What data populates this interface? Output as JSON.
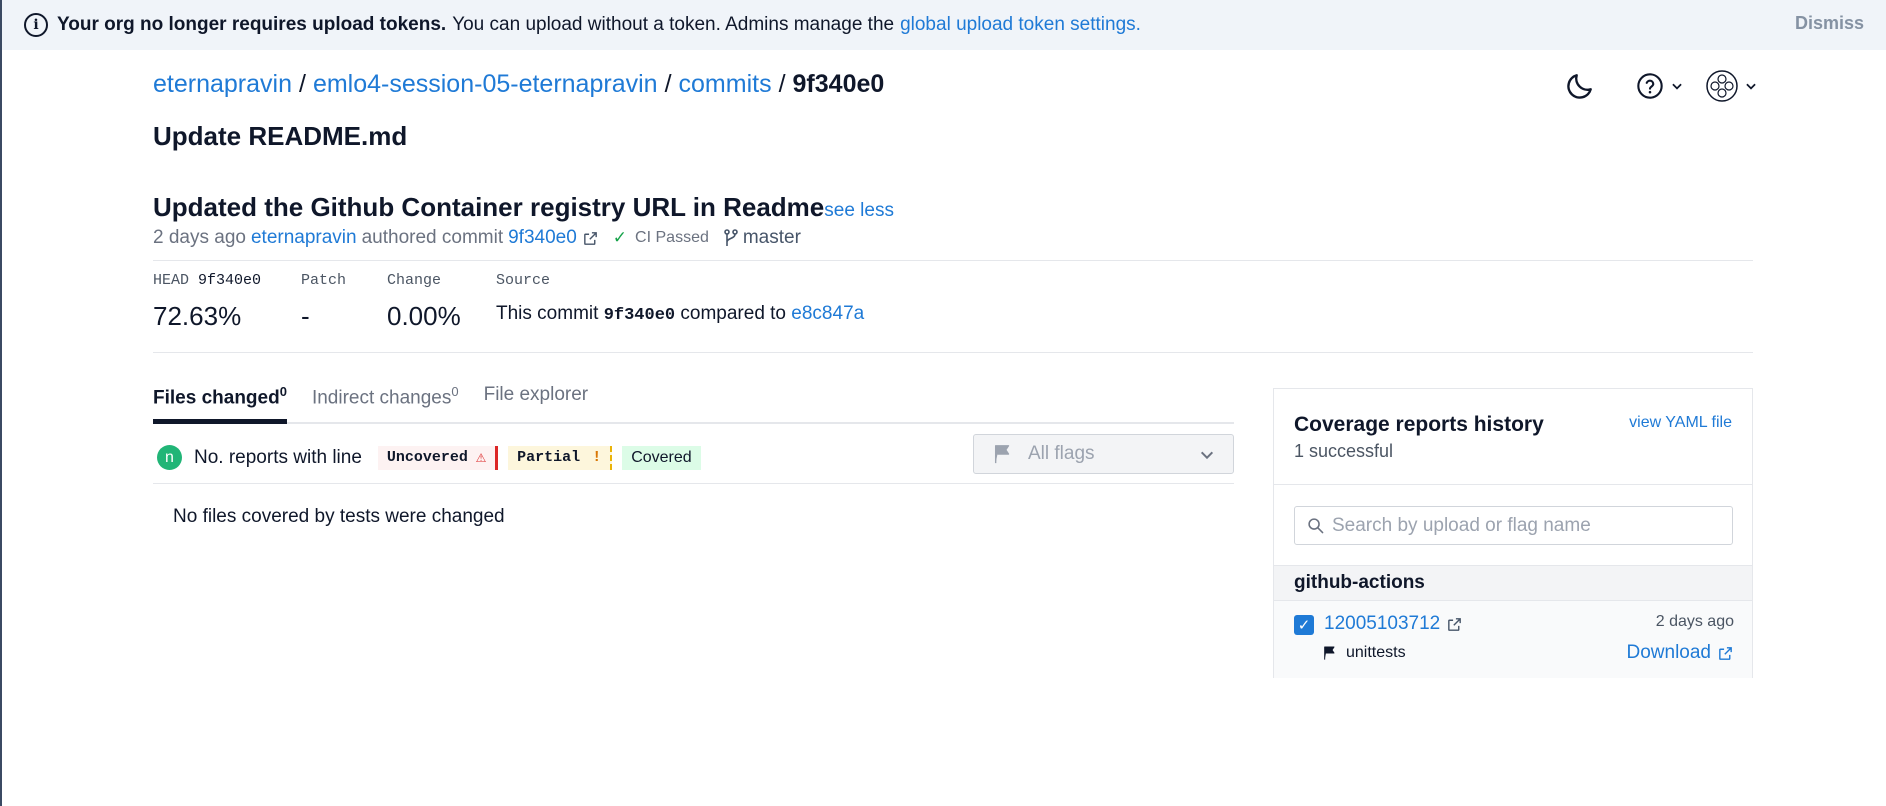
{
  "banner": {
    "bold_text": "Your org no longer requires upload tokens.",
    "text": "You can upload without a token. Admins manage the",
    "link": "global upload token settings.",
    "dismiss": "Dismiss"
  },
  "breadcrumb": {
    "owner": "eternapravin",
    "repo": "emlo4-session-05-eternapravin",
    "section": "commits",
    "current": "9f340e0",
    "separator": "/"
  },
  "page": {
    "title": "Update README.md"
  },
  "commit": {
    "message": "Updated the Github Container registry URL in Readme",
    "see_less": "see less",
    "time": "2 days ago",
    "author": "eternapravin",
    "authored_text": "authored commit",
    "sha": "9f340e0",
    "ci_status": "CI Passed",
    "branch": "master"
  },
  "stats": {
    "head_label": "HEAD",
    "head_sha": "9f340e0",
    "head_value": "72.63%",
    "patch_label": "Patch",
    "patch_value": "-",
    "change_label": "Change",
    "change_value": "0.00%",
    "source_label": "Source",
    "source_prefix": "This commit",
    "source_sha": "9f340e0",
    "source_mid": "compared to",
    "source_base": "e8c847a"
  },
  "tabs": [
    {
      "label": "Files changed",
      "count": "0"
    },
    {
      "label": "Indirect changes",
      "count": "0"
    },
    {
      "label": "File explorer",
      "count": ""
    }
  ],
  "legend": {
    "badge": "n",
    "text": "No. reports with line",
    "uncovered": "Uncovered",
    "partial": "Partial",
    "partial_mark": "!",
    "covered": "Covered"
  },
  "flags_select": {
    "value": "All flags"
  },
  "files": {
    "empty_message": "No files covered by tests were changed"
  },
  "coverage_panel": {
    "title": "Coverage reports history",
    "subtitle": "1 successful",
    "yaml_link": "view YAML file",
    "search_placeholder": "Search by upload or flag name",
    "group": "github-actions",
    "upload": {
      "id": "12005103712",
      "time": "2 days ago",
      "flag": "unittests",
      "download": "Download"
    }
  },
  "colors": {
    "link": "#1f7ad6",
    "banner_bg": "#f0f4f9",
    "ci_check": "#16a34a",
    "uncovered": "#dc2626",
    "partial": "#eab308",
    "covered_bg": "#dcfce7",
    "badge": "#21b577"
  }
}
